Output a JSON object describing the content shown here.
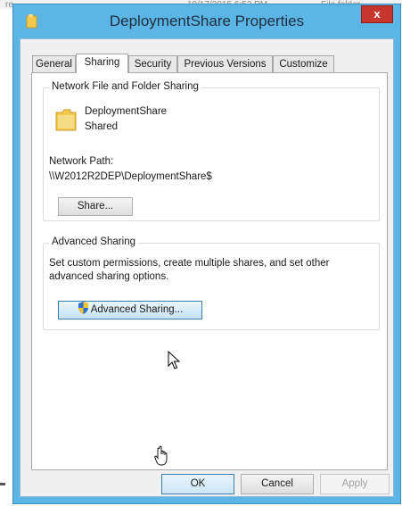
{
  "background": {
    "left_fragment": "re",
    "timestamp": "10/17/2015 6:52 PM",
    "type": "File folder"
  },
  "window": {
    "title": "DeploymentShare Properties",
    "close_label": "x"
  },
  "tabs": [
    {
      "label": "General",
      "active": false
    },
    {
      "label": "Sharing",
      "active": true
    },
    {
      "label": "Security",
      "active": false
    },
    {
      "label": "Previous Versions",
      "active": false
    },
    {
      "label": "Customize",
      "active": false
    }
  ],
  "network_sharing": {
    "group_label": "Network File and Folder Sharing",
    "folder_name": "DeploymentShare",
    "folder_status": "Shared",
    "path_label": "Network Path:",
    "path_value": "\\\\W2012R2DEP\\DeploymentShare$",
    "share_button": "Share..."
  },
  "advanced_sharing": {
    "group_label": "Advanced Sharing",
    "description_line1": "Set custom permissions, create multiple shares, and set other",
    "description_line2": "advanced sharing options.",
    "button_label": "Advanced Sharing..."
  },
  "footer": {
    "ok_label": "OK",
    "cancel_label": "Cancel",
    "apply_label": "Apply"
  },
  "colors": {
    "title_bar": "#5bb6e6",
    "close_button": "#c8372d",
    "focus_border": "#3c7fb1"
  },
  "icons": [
    "folder-icon",
    "shield-icon",
    "close-icon",
    "arrow-cursor",
    "hand-cursor"
  ]
}
